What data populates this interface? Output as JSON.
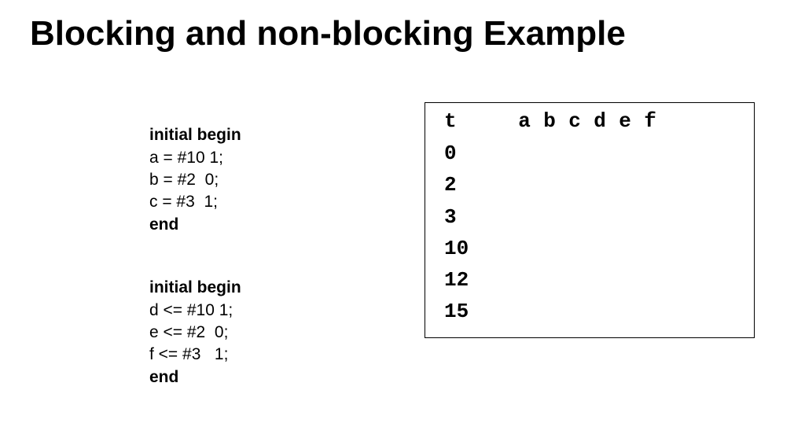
{
  "title": "Blocking and non-blocking Example",
  "code": {
    "block1": {
      "header": "initial begin",
      "line1": "a = #10 1;",
      "line2": "b = #2  0;",
      "line3": "c = #3  1;",
      "end": "end"
    },
    "block2": {
      "header": "initial begin",
      "line1": "d <= #10 1;",
      "line2": "e <= #2  0;",
      "line3": "f <= #3   1;",
      "end": "end"
    }
  },
  "table": {
    "header": [
      "t",
      "a",
      "b",
      "c",
      "d",
      "e",
      "f"
    ],
    "times": [
      "0",
      "2",
      "3",
      "10",
      "12",
      "15"
    ]
  }
}
